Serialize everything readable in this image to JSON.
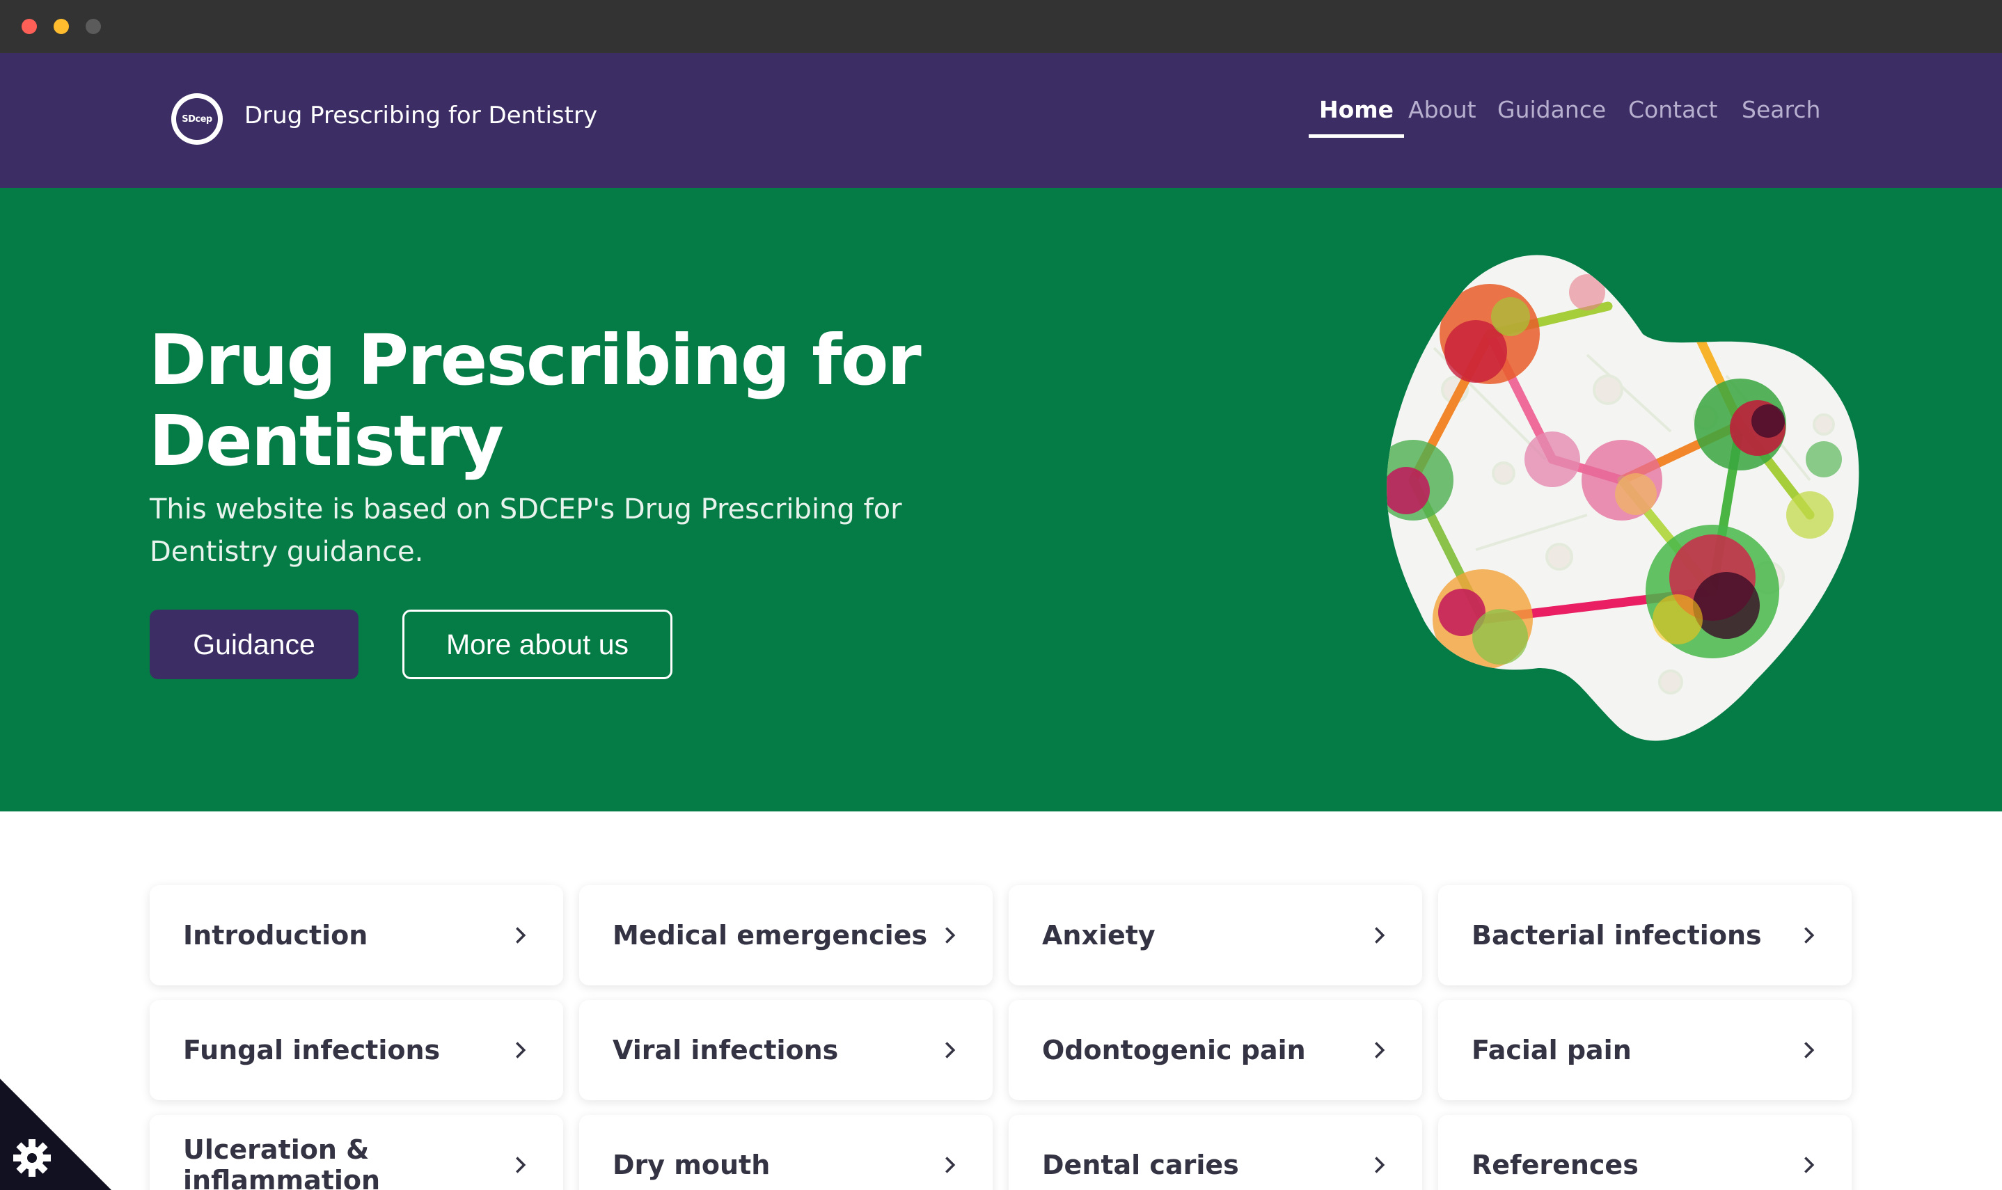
{
  "window": {
    "controls": [
      "close",
      "minimize",
      "zoom"
    ]
  },
  "header": {
    "logo_text": "SDcep",
    "site_title": "Drug Prescribing for Dentistry",
    "nav": [
      {
        "label": "Home",
        "active": true
      },
      {
        "label": "About",
        "active": false
      },
      {
        "label": "Guidance",
        "active": false
      },
      {
        "label": "Contact",
        "active": false
      },
      {
        "label": "Search",
        "active": false
      }
    ]
  },
  "hero": {
    "title": "Drug Prescribing for Dentistry",
    "subtitle": "This website is based on SDCEP's Drug Prescribing for Dentistry guidance.",
    "primary_button": "Guidance",
    "secondary_button": "More about us"
  },
  "cards": [
    {
      "label": "Introduction"
    },
    {
      "label": "Medical emergencies"
    },
    {
      "label": "Anxiety"
    },
    {
      "label": "Bacterial infections"
    },
    {
      "label": "Fungal infections"
    },
    {
      "label": "Viral infections"
    },
    {
      "label": "Odontogenic pain"
    },
    {
      "label": "Facial pain"
    },
    {
      "label": "Ulceration & inflammation"
    },
    {
      "label": "Dry mouth"
    },
    {
      "label": "Dental caries"
    },
    {
      "label": "References"
    }
  ],
  "colors": {
    "header_bg": "#3c2d64",
    "hero_bg": "#057c45",
    "primary_button_bg": "#3c2d64",
    "card_text": "#333344"
  },
  "icons": {
    "card_arrow": "chevron-right-icon",
    "cookie": "gear-icon"
  }
}
